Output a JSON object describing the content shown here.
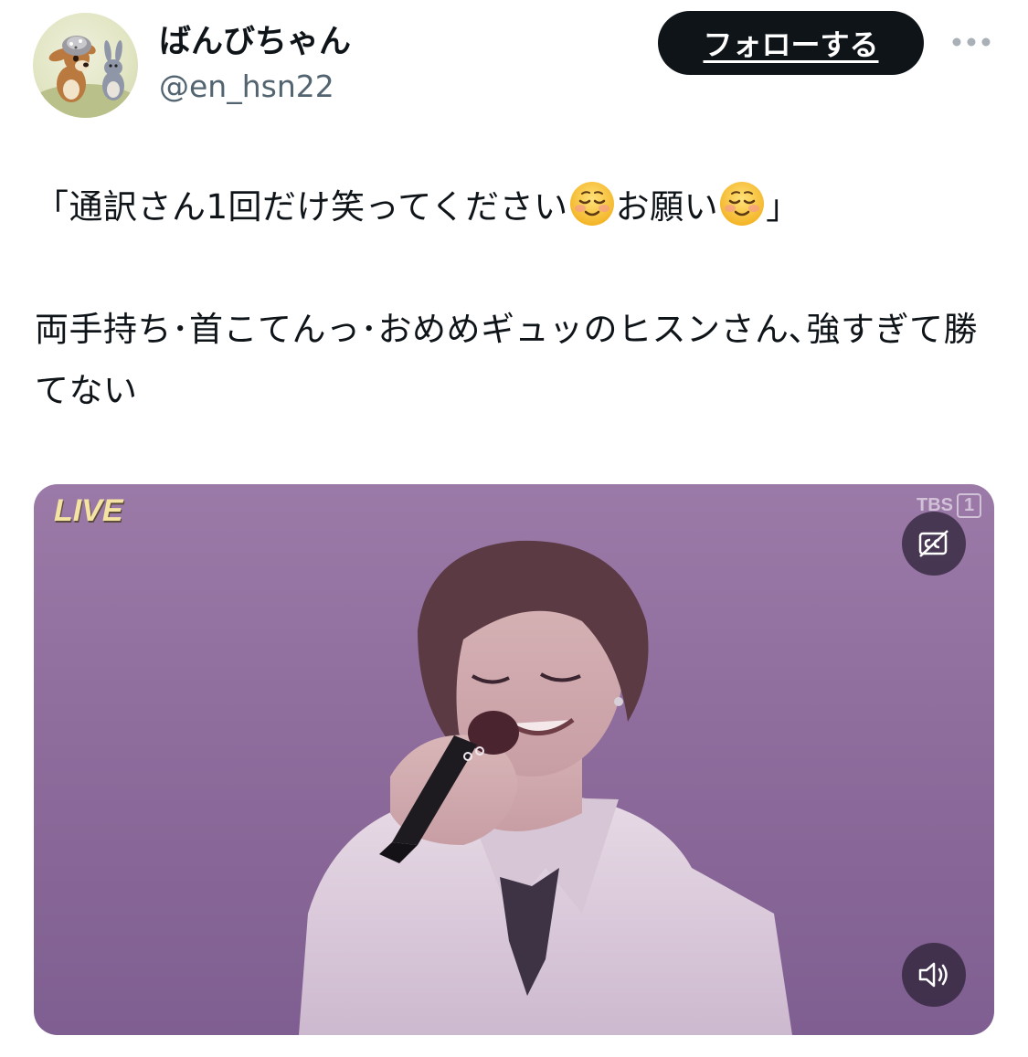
{
  "header": {
    "display_name": "ばんびちゃん",
    "handle": "@en_hsn22",
    "follow_label": "フォローする"
  },
  "tweet": {
    "line1_a": "「通訳さん1回だけ笑ってください",
    "line1_b": "お願い",
    "line1_c": "」",
    "line2": "両手持ち･首こてんっ･おめめギュッのヒスンさん､強すぎて勝てない",
    "emoji": "smiling-face-emoji"
  },
  "media": {
    "overlay_label": "LIVE",
    "broadcaster": "TBS",
    "channel": "1",
    "captions_icon": "captions-off-icon",
    "volume_icon": "speaker-icon"
  },
  "colors": {
    "text": "#0f1419",
    "secondary_text": "#536471",
    "follow_button_bg": "#0f1419",
    "media_bg": "#9b7aa8",
    "live_label": "#f4e3a2"
  }
}
